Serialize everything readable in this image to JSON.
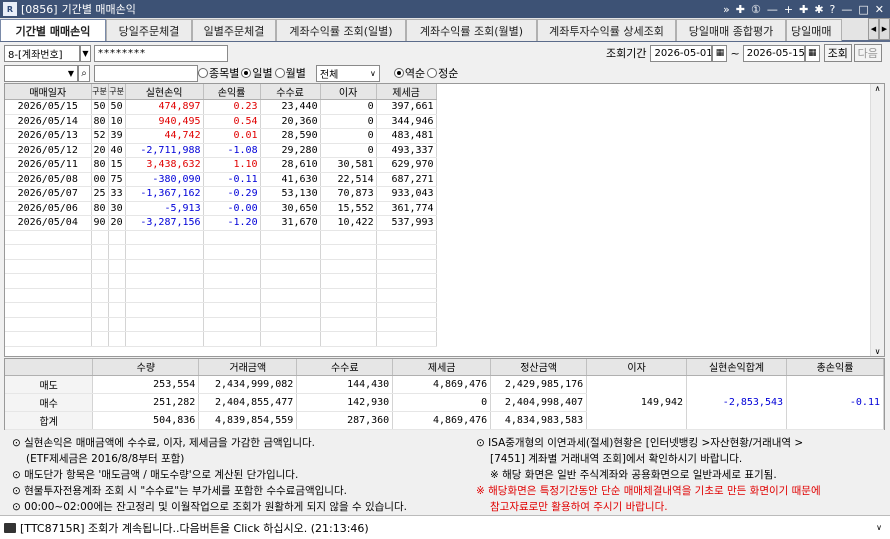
{
  "window": {
    "id": "[0856]",
    "title": "기간별 매매손익",
    "controls": [
      "»",
      "✚",
      "①",
      "—",
      "+",
      "✚",
      "✱",
      "?",
      "—",
      "□",
      "✕"
    ]
  },
  "tabs": [
    {
      "label": "기간별 매매손익",
      "active": true
    },
    {
      "label": "당일주문체결"
    },
    {
      "label": "일별주문체결"
    },
    {
      "label": "계좌수익률 조회(일별)"
    },
    {
      "label": "계좌수익률 조회(월별)"
    },
    {
      "label": "계좌투자수익률 상세조회"
    },
    {
      "label": "당일매매 종합평가"
    },
    {
      "label": "당일매매"
    }
  ],
  "account": {
    "number": "8-[계좌번호]",
    "password": "********"
  },
  "filter": {
    "mode_options": [
      "종목별",
      "일별",
      "월별"
    ],
    "mode_selected": "일별",
    "type_value": "전체",
    "order_options": [
      "역순",
      "정순"
    ],
    "order_selected": "역순"
  },
  "period": {
    "label": "조회기간",
    "start": "2026-05-01",
    "sep": "~",
    "end": "2026-05-15",
    "query_btn": "조회",
    "next_btn": "다음"
  },
  "grid": {
    "headers": [
      "매매일자",
      "구분",
      "구분",
      "실현손익",
      "손익률",
      "수수료",
      "이자",
      "제세금"
    ],
    "rows": [
      {
        "date": "2026/05/15",
        "a": "50",
        "b": "50",
        "pnl": "474,897",
        "rate": "0.23",
        "fee": "23,440",
        "int": "0",
        "tax": "397,661",
        "neg": false
      },
      {
        "date": "2026/05/14",
        "a": "80",
        "b": "10",
        "pnl": "940,495",
        "rate": "0.54",
        "fee": "20,360",
        "int": "0",
        "tax": "344,946",
        "neg": false
      },
      {
        "date": "2026/05/13",
        "a": "52",
        "b": "39",
        "pnl": "44,742",
        "rate": "0.01",
        "fee": "28,590",
        "int": "0",
        "tax": "483,481",
        "neg": false
      },
      {
        "date": "2026/05/12",
        "a": "20",
        "b": "40",
        "pnl": "-2,711,988",
        "rate": "-1.08",
        "fee": "29,280",
        "int": "0",
        "tax": "493,337",
        "neg": true
      },
      {
        "date": "2026/05/11",
        "a": "80",
        "b": "15",
        "pnl": "3,438,632",
        "rate": "1.10",
        "fee": "28,610",
        "int": "30,581",
        "tax": "629,970",
        "neg": false
      },
      {
        "date": "2026/05/08",
        "a": "00",
        "b": "75",
        "pnl": "-380,090",
        "rate": "-0.11",
        "fee": "41,630",
        "int": "22,514",
        "tax": "687,271",
        "neg": true
      },
      {
        "date": "2026/05/07",
        "a": "25",
        "b": "33",
        "pnl": "-1,367,162",
        "rate": "-0.29",
        "fee": "53,130",
        "int": "70,873",
        "tax": "933,043",
        "neg": true
      },
      {
        "date": "2026/05/06",
        "a": "80",
        "b": "30",
        "pnl": "-5,913",
        "rate": "-0.00",
        "fee": "30,650",
        "int": "15,552",
        "tax": "361,774",
        "neg": true
      },
      {
        "date": "2026/05/04",
        "a": "90",
        "b": "20",
        "pnl": "-3,287,156",
        "rate": "-1.20",
        "fee": "31,670",
        "int": "10,422",
        "tax": "537,993",
        "neg": true
      }
    ]
  },
  "summary": {
    "headers": [
      "수량",
      "거래금액",
      "수수료",
      "제세금",
      "정산금액",
      "이자",
      "실현손익합계",
      "총손익률"
    ],
    "rows": [
      {
        "label": "매도",
        "qty": "253,554",
        "amt": "2,434,999,082",
        "fee": "144,430",
        "tax": "4,869,476",
        "settle": "2,429,985,176"
      },
      {
        "label": "매수",
        "qty": "251,282",
        "amt": "2,404,855,477",
        "fee": "142,930",
        "tax": "0",
        "settle": "2,404,998,407"
      },
      {
        "label": "합계",
        "qty": "504,836",
        "amt": "4,839,854,559",
        "fee": "287,360",
        "tax": "4,869,476",
        "settle": "4,834,983,583"
      }
    ],
    "interest": "149,942",
    "total_pnl": "-2,853,543",
    "total_rate": "-0.11"
  },
  "notes": {
    "left": [
      "⊙ 실현손익은 매매금액에 수수료, 이자, 제세금을 가감한 금액입니다.",
      "(ETF제세금은 2016/8/8부터 포함)",
      "⊙ 매도단가 항목은 '매도금액 / 매도수량'으로 계산된 단가입니다.",
      "⊙ 현물투자전용계좌 조회 시 \"수수료\"는 부가세를 포함한 수수료금액입니다.",
      "⊙ 00:00~02:00에는 잔고정리 및 이월작업으로 조회가 원활하게 되지 않을 수 있습니다."
    ],
    "right": [
      "⊙ ISA중개형의 이연과세(절세)현황은 [인터넷뱅킹 >자산현황/거래내역 >",
      "[7451] 계좌별 거래내역 조회]에서 확인하시기 바랍니다.",
      "※ 해당 화면은 일반 주식계좌와 공용화면으로 일반과세로 표기됨.",
      "※ 해당화면은 특정기간동안 단순 매매체결내역을 기초로 만든 화면이기 때문에",
      "참고자료로만 활용하여 주시기 바랍니다."
    ],
    "warn_color": "#e00000"
  },
  "status": {
    "text": "[TTC8715R] 조회가 계속됩니다..다음버튼을 Click 하십시오. (21:13:46)"
  }
}
